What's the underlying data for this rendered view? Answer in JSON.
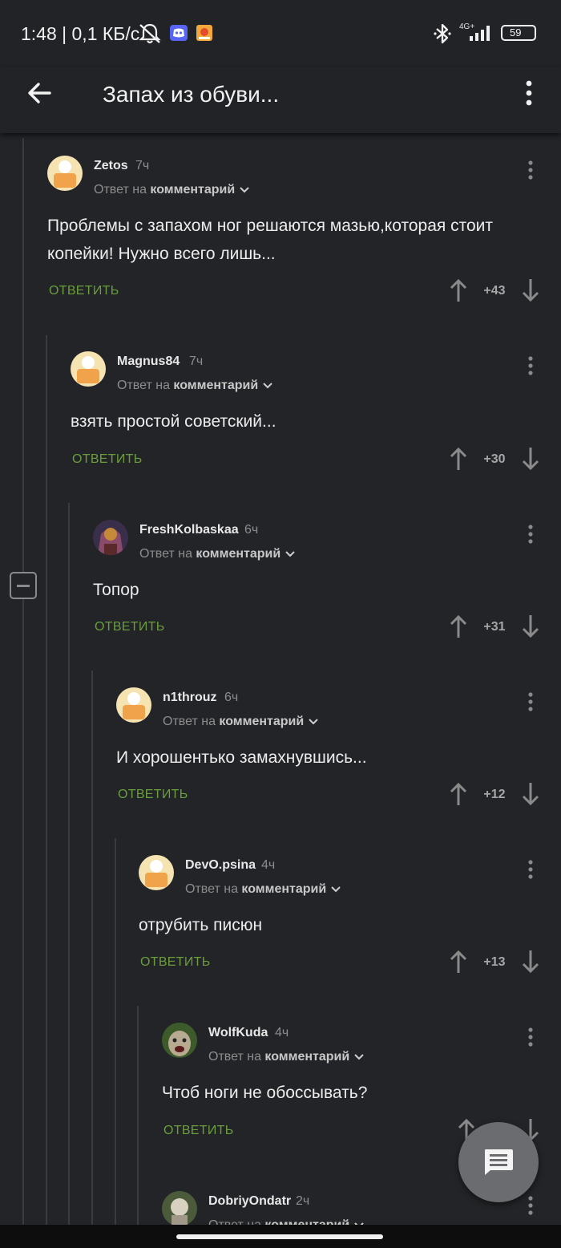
{
  "status_bar": {
    "time": "1:48 | 0,1 КБ/с",
    "network": "4G+",
    "battery": "59"
  },
  "header": {
    "title": "Запах из обуви..."
  },
  "common": {
    "reply_prefix": "Ответ на",
    "reply_target": "комментарий",
    "reply_action": "ОТВЕТИТЬ"
  },
  "comments": [
    {
      "user": "Zetos",
      "time": "7ч",
      "text": "Проблемы с запахом ног решаются мазью,которая стоит копейки! Нужно всего лишь...",
      "score": "+43"
    },
    {
      "user": "Magnus84",
      "time": "7ч",
      "text": "взять простой советский...",
      "score": "+30"
    },
    {
      "user": "FreshKolbaskaa",
      "time": "6ч",
      "text": "Топор",
      "score": "+31"
    },
    {
      "user": "n1throuz",
      "time": "6ч",
      "text": "И хорошентько замахнувшись...",
      "score": "+12"
    },
    {
      "user": "DevO.psina",
      "time": "4ч",
      "text": "отрубить писюн",
      "score": "+13"
    },
    {
      "user": "WolfKuda",
      "time": "4ч",
      "text": "Чтоб ноги не обоссывать?",
      "score": ""
    },
    {
      "user": "DobriyOndatr",
      "time": "2ч",
      "text": "",
      "score": ""
    }
  ],
  "colors": {
    "background": "#232427",
    "accent_green": "#6a9e3c",
    "muted": "#8d8d8d"
  }
}
